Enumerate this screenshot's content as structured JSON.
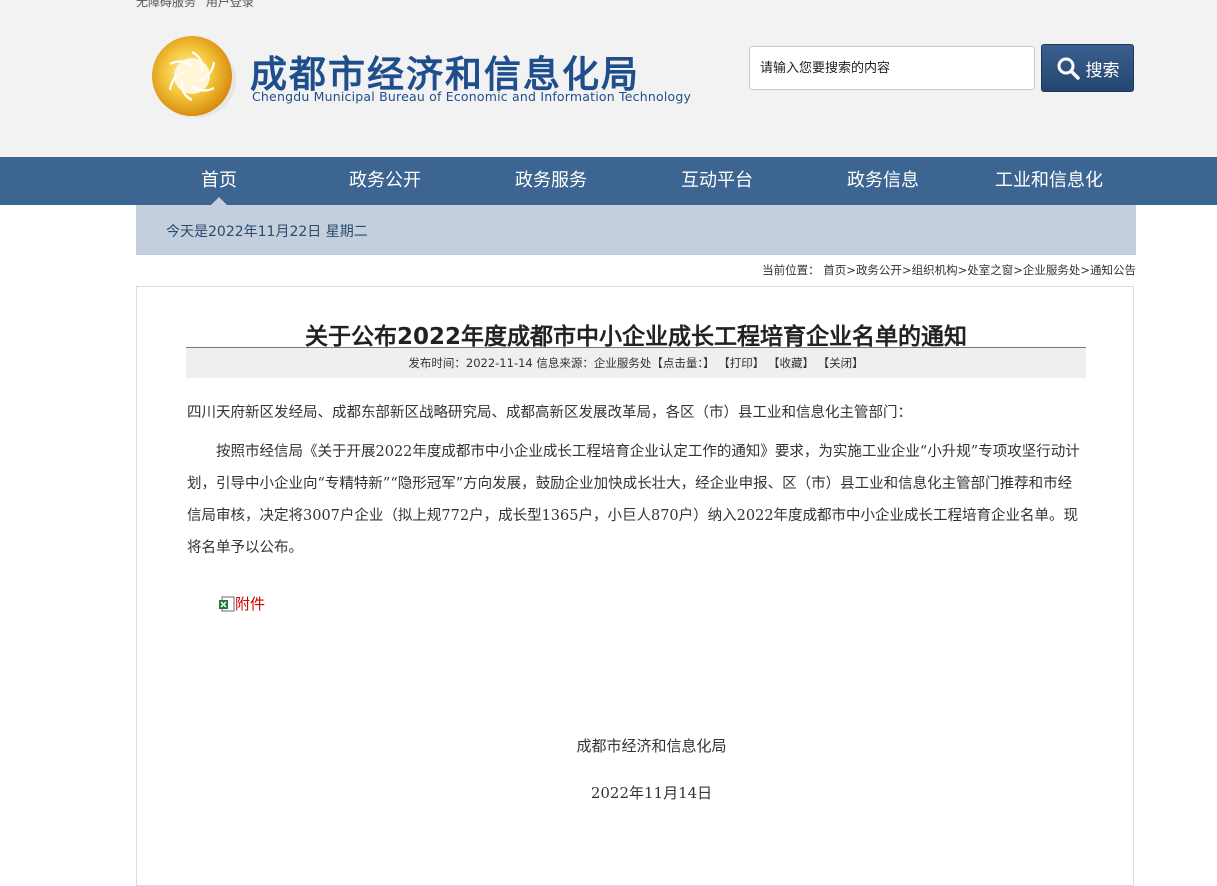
{
  "top_links": [
    "无障碍服务",
    "用户登录"
  ],
  "header": {
    "logo_cn": "成都市经济和信息化局",
    "logo_en": "Chengdu Municipal Bureau of Economic and Information Technology",
    "search_placeholder": "请输入您要搜索的内容",
    "search_label": "搜索"
  },
  "nav": [
    "首页",
    "政务公开",
    "政务服务",
    "互动平台",
    "政务信息",
    "工业和信息化"
  ],
  "date_text": "今天是2022年11月22日 星期二",
  "breadcrumb": {
    "prefix": "当前位置：",
    "items": [
      "首页",
      "政务公开",
      "组织机构",
      "处室之窗",
      "企业服务处",
      "通知公告"
    ]
  },
  "article": {
    "title": "关于公布2022年度成都市中小企业成长工程培育企业名单的通知",
    "meta_prefix": "发布时间：2022-11-14 信息来源：企业服务处【点击量：】",
    "print": "【打印】",
    "favorite": "【收藏】",
    "close": "【关闭】",
    "addressee": "四川天府新区发经局、成都东部新区战略研究局、成都高新区发展改革局，各区（市）县工业和信息化主管部门：",
    "paragraph": "按照市经信局《关于开展2022年度成都市中小企业成长工程培育企业认定工作的通知》要求，为实施工业企业“小升规”专项攻坚行动计划，引导中小企业向“专精特新”“隐形冠军”方向发展，鼓励企业加快成长壮大，经企业申报、区（市）县工业和信息化主管部门推荐和市经信局审核，决定将3007户企业（拟上规772户，成长型1365户，小巨人870户）纳入2022年度成都市中小企业成长工程培育企业名单。现将名单予以公布。",
    "attachment_label": "附件",
    "signer": "成都市经济和信息化局",
    "sign_date": "2022年11月14日"
  }
}
